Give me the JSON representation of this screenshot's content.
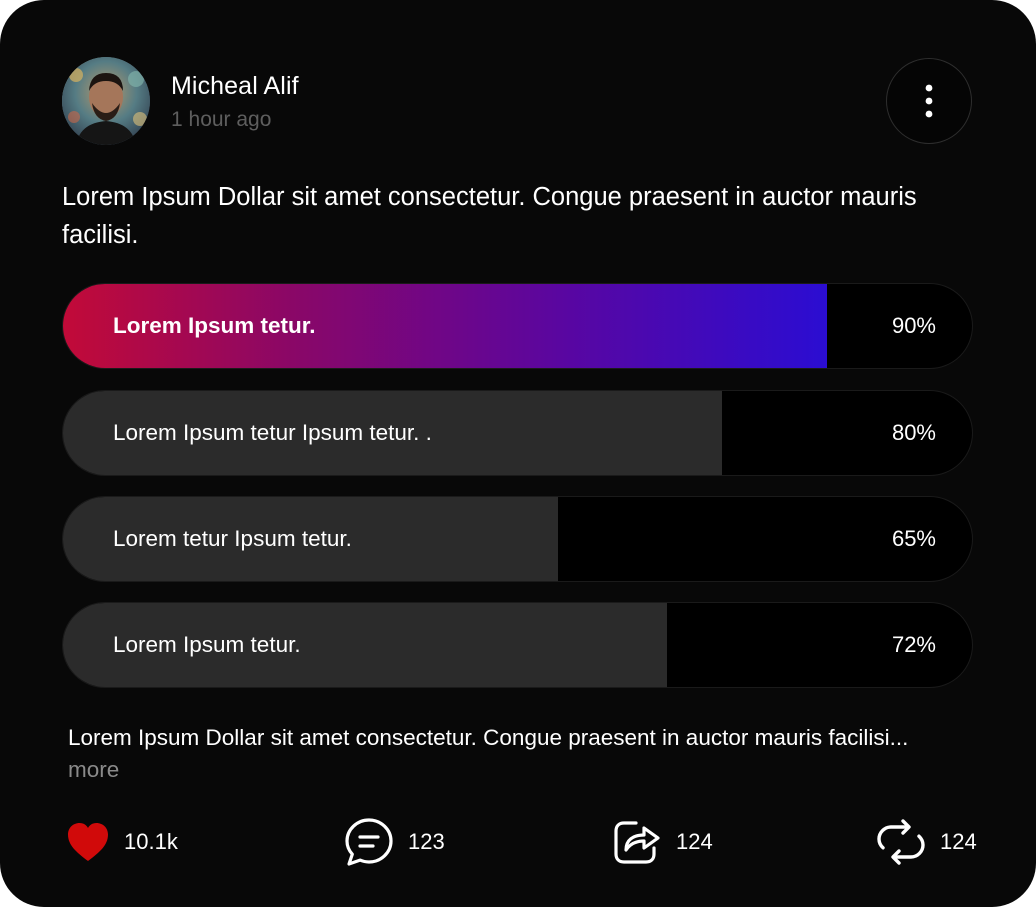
{
  "post": {
    "author": "Micheal Alif",
    "time": "1 hour ago",
    "text": "Lorem Ipsum Dollar sit amet consectetur. Congue praesent in auctor mauris facilisi."
  },
  "poll": {
    "options": [
      {
        "label": "Lorem Ipsum tetur.",
        "percent": "90%",
        "value": 84,
        "winner": true
      },
      {
        "label": "Lorem Ipsum tetur Ipsum tetur. .",
        "percent": "80%",
        "value": 72.5,
        "winner": false
      },
      {
        "label": "Lorem tetur Ipsum tetur.",
        "percent": "65%",
        "value": 54.5,
        "winner": false
      },
      {
        "label": "Lorem Ipsum tetur.",
        "percent": "72%",
        "value": 66.5,
        "winner": false
      }
    ]
  },
  "caption": {
    "text": "Lorem Ipsum Dollar sit amet consectetur. Congue praesent in auctor mauris facilisi...",
    "more": "more"
  },
  "actions": {
    "likes": "10.1k",
    "comments": "123",
    "shares": "124",
    "reposts": "124"
  },
  "colors": {
    "background": "#080808",
    "winner_gradient_start": "#c20a38",
    "winner_gradient_end": "#2b0dd2",
    "bar_fill": "#2b2b2b",
    "like_red": "#d10a0a",
    "muted_text": "#5e5e5e"
  },
  "icons": {
    "menu": "more-vertical-icon",
    "like": "heart-icon",
    "comment": "chat-bubble-icon",
    "share": "share-arrow-icon",
    "repost": "repeat-icon"
  }
}
